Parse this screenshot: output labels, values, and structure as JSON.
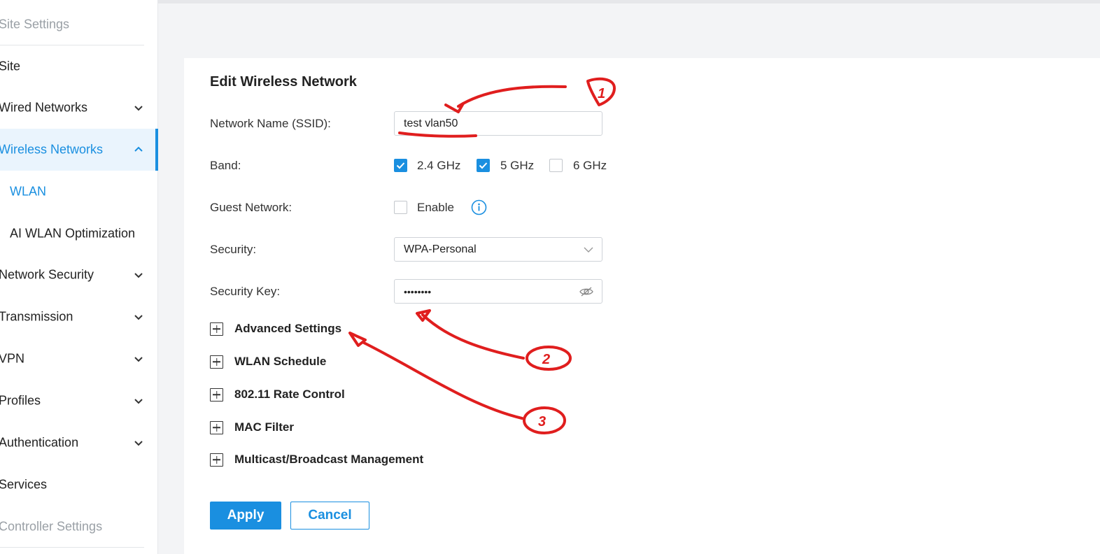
{
  "sidebar": {
    "section_site": "Site Settings",
    "items": [
      {
        "label": "Site"
      },
      {
        "label": "Wired Networks"
      },
      {
        "label": "Wireless Networks"
      },
      {
        "label": "WLAN"
      },
      {
        "label": "AI WLAN Optimization"
      },
      {
        "label": "Network Security"
      },
      {
        "label": "Transmission"
      },
      {
        "label": "VPN"
      },
      {
        "label": "Profiles"
      },
      {
        "label": "Authentication"
      },
      {
        "label": "Services"
      }
    ],
    "section_controller": "Controller Settings"
  },
  "form": {
    "title": "Edit Wireless Network",
    "ssid_label": "Network Name (SSID):",
    "ssid_value": "test vlan50",
    "band_label": "Band:",
    "band_options": [
      {
        "label": "2.4 GHz",
        "checked": true
      },
      {
        "label": "5 GHz",
        "checked": true
      },
      {
        "label": "6 GHz",
        "checked": false
      }
    ],
    "guest_label": "Guest Network:",
    "guest_option": {
      "label": "Enable",
      "checked": false
    },
    "security_label": "Security:",
    "security_value": "WPA-Personal",
    "key_label": "Security Key:",
    "key_value": "••••••••",
    "sections": [
      {
        "label": "Advanced Settings"
      },
      {
        "label": "WLAN Schedule"
      },
      {
        "label": "802.11 Rate Control"
      },
      {
        "label": "MAC Filter"
      },
      {
        "label": "Multicast/Broadcast Management"
      }
    ],
    "apply_label": "Apply",
    "cancel_label": "Cancel"
  },
  "colors": {
    "accent": "#1a8fe0",
    "annotation": "#e01e1e"
  },
  "annotations": [
    "1",
    "2",
    "3"
  ]
}
